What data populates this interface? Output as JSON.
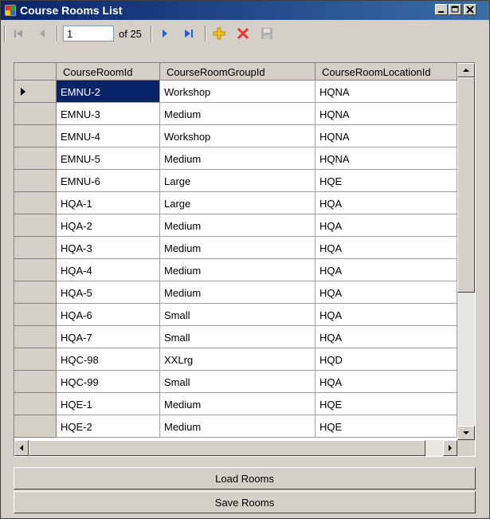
{
  "window": {
    "title": "Course Rooms List"
  },
  "navigator": {
    "position": "1",
    "count_label": "of 25"
  },
  "grid": {
    "columns": [
      "CourseRoomId",
      "CourseRoomGroupId",
      "CourseRoomLocationId"
    ],
    "rows": [
      [
        "EMNU-2",
        "Workshop",
        "HQNA"
      ],
      [
        "EMNU-3",
        "Medium",
        "HQNA"
      ],
      [
        "EMNU-4",
        "Workshop",
        "HQNA"
      ],
      [
        "EMNU-5",
        "Medium",
        "HQNA"
      ],
      [
        "EMNU-6",
        "Large",
        "HQE"
      ],
      [
        "HQA-1",
        "Large",
        "HQA"
      ],
      [
        "HQA-2",
        "Medium",
        "HQA"
      ],
      [
        "HQA-3",
        "Medium",
        "HQA"
      ],
      [
        "HQA-4",
        "Medium",
        "HQA"
      ],
      [
        "HQA-5",
        "Medium",
        "HQA"
      ],
      [
        "HQA-6",
        "Small",
        "HQA"
      ],
      [
        "HQA-7",
        "Small",
        "HQA"
      ],
      [
        "HQC-98",
        "XXLrg",
        "HQD"
      ],
      [
        "HQC-99",
        "Small",
        "HQA"
      ],
      [
        "HQE-1",
        "Medium",
        "HQE"
      ],
      [
        "HQE-2",
        "Medium",
        "HQE"
      ]
    ]
  },
  "buttons": {
    "load": "Load Rooms",
    "save": "Save Rooms"
  }
}
